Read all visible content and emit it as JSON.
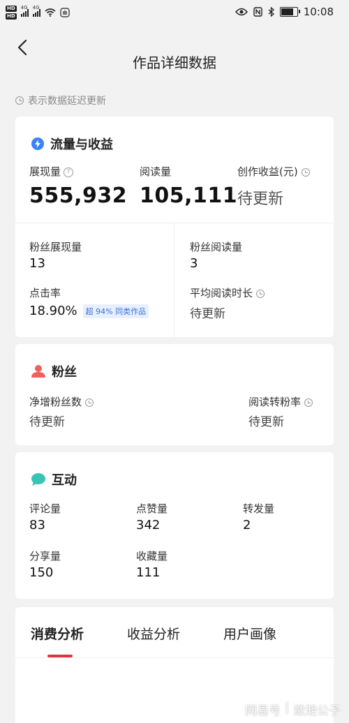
{
  "status_bar": {
    "left_tags": [
      "HD",
      "HD"
    ],
    "sim1_label": "4G",
    "sim2_label": "4G",
    "time": "10:08",
    "battery_level": 0.85
  },
  "header": {
    "title": "作品详细数据"
  },
  "notice": "表示数据延迟更新",
  "traffic": {
    "title": "流量与收益",
    "impressions_label": "展现量",
    "impressions_value": "555,932",
    "reads_label": "阅读量",
    "reads_value": "105,111",
    "earnings_label": "创作收益(元)",
    "earnings_value": "待更新",
    "fan_impressions_label": "粉丝展现量",
    "fan_impressions_value": "13",
    "fan_reads_label": "粉丝阅读量",
    "fan_reads_value": "3",
    "ctr_label": "点击率",
    "ctr_value": "18.90%",
    "ctr_tag": "超 94% 同类作品",
    "avg_read_label": "平均阅读时长",
    "avg_read_value": "待更新"
  },
  "fans": {
    "title": "粉丝",
    "net_label": "净增粉丝数",
    "net_value": "待更新",
    "conv_label": "阅读转粉率",
    "conv_value": "待更新"
  },
  "interaction": {
    "title": "互动",
    "comments_label": "评论量",
    "comments_value": "83",
    "likes_label": "点赞量",
    "likes_value": "342",
    "reposts_label": "转发量",
    "reposts_value": "2",
    "shares_label": "分享量",
    "shares_value": "150",
    "favorites_label": "收藏量",
    "favorites_value": "111"
  },
  "tabs": [
    "消费分析",
    "收益分析",
    "用户画像"
  ],
  "watermark": {
    "left": "网易号",
    "right": "潋滟公子"
  },
  "colors": {
    "accent_red": "#e0353f",
    "lightning_blue": "#3b82f6",
    "fans_red": "#f0605a",
    "chat_teal": "#36c4b4"
  }
}
